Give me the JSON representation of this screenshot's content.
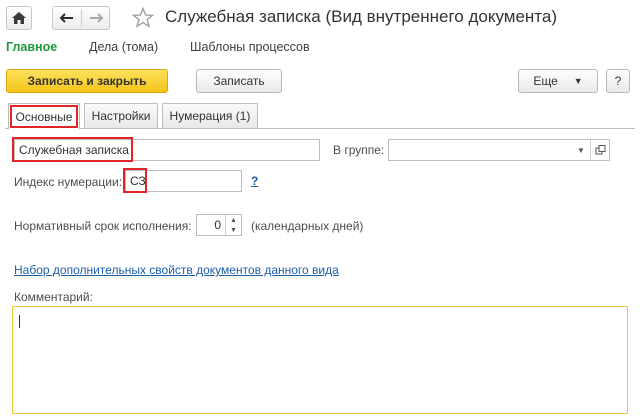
{
  "window": {
    "title": "Служебная записка (Вид внутреннего документа)"
  },
  "navigation": {
    "items": [
      {
        "label": "Главное",
        "active": true
      },
      {
        "label": "Дела (тома)",
        "active": false
      },
      {
        "label": "Шаблоны процессов",
        "active": false
      }
    ]
  },
  "toolbar": {
    "save_close_label": "Записать и закрыть",
    "save_label": "Записать",
    "more_label": "Еще",
    "help_label": "?"
  },
  "tabs": [
    {
      "label": "Основные",
      "active": true
    },
    {
      "label": "Настройки",
      "active": false
    },
    {
      "label": "Нумерация (1)",
      "active": false
    }
  ],
  "form": {
    "name_value": "Служебная записка",
    "group_label": "В группе:",
    "group_value": "",
    "index_label": "Индекс нумерации:",
    "index_value": "СЗ",
    "index_help": "?",
    "deadline_label": "Нормативный срок исполнения:",
    "deadline_value": "0",
    "deadline_unit": "(календарных дней)",
    "properties_link": "Набор дополнительных свойств документов данного вида",
    "comment_label": "Комментарий:",
    "comment_value": ""
  },
  "colors": {
    "accent_green": "#1f9a3b",
    "primary_button": "#f4c418",
    "highlight_red": "#e0242a",
    "link_blue": "#1c5dac",
    "focus_yellow": "#f2c230"
  }
}
